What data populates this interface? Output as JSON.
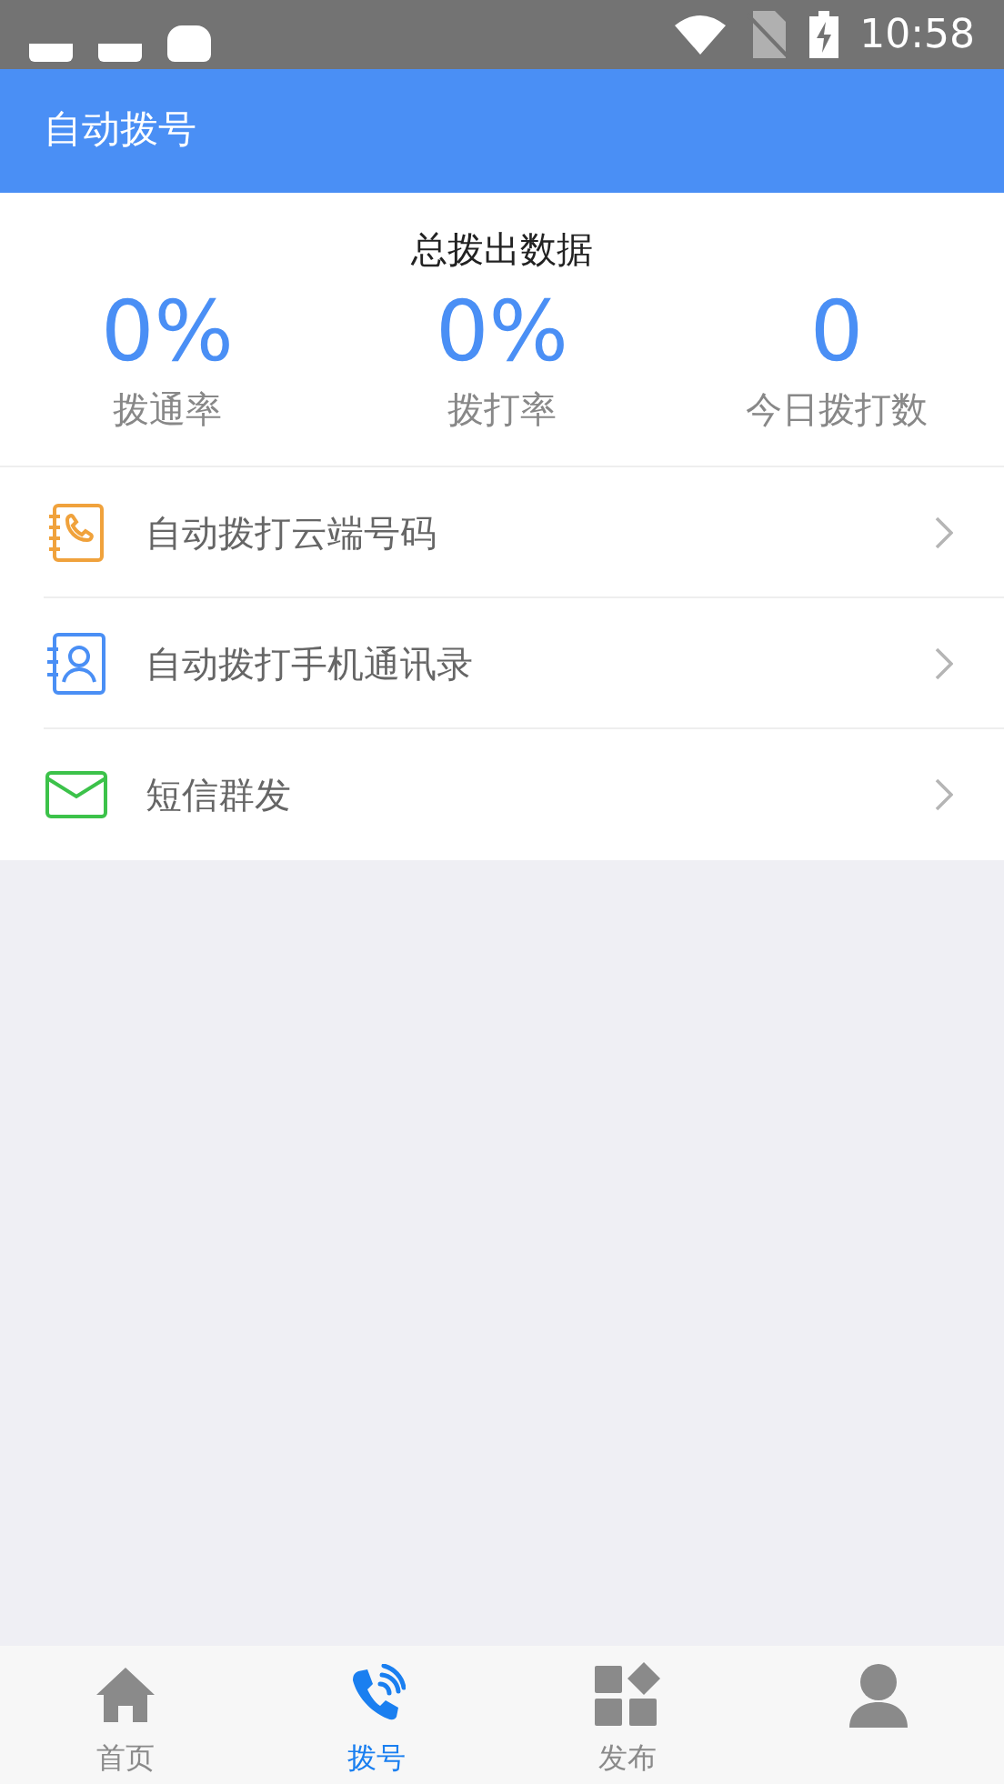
{
  "status_bar": {
    "time": "10:58"
  },
  "header": {
    "title": "自动拨号"
  },
  "stats": {
    "title": "总拨出数据",
    "items": [
      {
        "value": "0%",
        "label": "拨通率"
      },
      {
        "value": "0%",
        "label": "拨打率"
      },
      {
        "value": "0",
        "label": "今日拨打数"
      }
    ]
  },
  "menu": [
    {
      "kind": "cloud",
      "label": "自动拨打云端号码"
    },
    {
      "kind": "contacts",
      "label": "自动拨打手机通讯录"
    },
    {
      "kind": "sms",
      "label": "短信群发"
    }
  ],
  "tabs": [
    {
      "kind": "home",
      "label": "首页",
      "selected": false
    },
    {
      "kind": "dial",
      "label": "拨号",
      "selected": true
    },
    {
      "kind": "publish",
      "label": "发布",
      "selected": false
    },
    {
      "kind": "me",
      "selected": false
    }
  ]
}
